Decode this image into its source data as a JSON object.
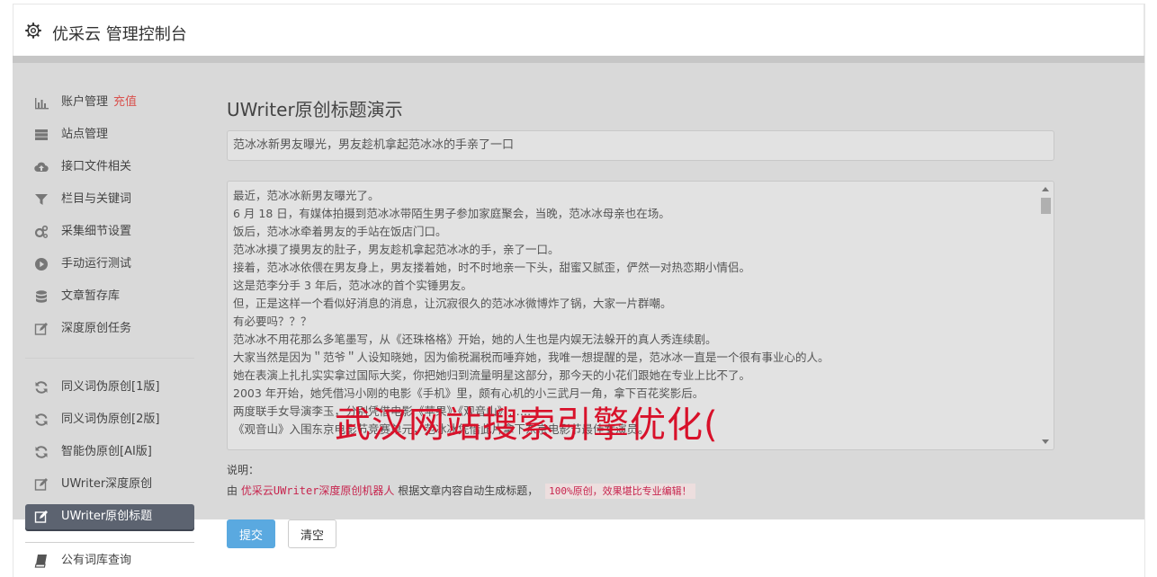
{
  "header": {
    "title": "优采云 管理控制台"
  },
  "sidebar": {
    "items": [
      {
        "label": "账户管理",
        "badge": "充值",
        "icon": "bar-chart-icon"
      },
      {
        "label": "站点管理",
        "icon": "server-icon"
      },
      {
        "label": "接口文件相关",
        "icon": "cloud-upload-icon"
      },
      {
        "label": "栏目与关键词",
        "icon": "filter-icon"
      },
      {
        "label": "采集细节设置",
        "icon": "gears-icon"
      },
      {
        "label": "手动运行测试",
        "icon": "play-icon"
      },
      {
        "label": "文章暂存库",
        "icon": "database-icon"
      },
      {
        "label": "深度原创任务",
        "icon": "edit-icon"
      }
    ],
    "items2": [
      {
        "label": "同义词伪原创[1版]",
        "icon": "refresh-icon"
      },
      {
        "label": "同义词伪原创[2版]",
        "icon": "refresh-icon"
      },
      {
        "label": "智能伪原创[AI版]",
        "icon": "refresh-icon"
      },
      {
        "label": "UWriter深度原创",
        "icon": "edit-icon"
      },
      {
        "label": "UWriter原创标题",
        "icon": "edit-icon",
        "active": true
      }
    ],
    "items3": [
      {
        "label": "公有词库查询",
        "icon": "book-icon"
      }
    ]
  },
  "main": {
    "title": "UWriter原创标题演示",
    "title_input_value": "范冰冰新男友曝光，男友趁机拿起范冰冰的手亲了一口",
    "content_lines": [
      "最近，范冰冰新男友曝光了。",
      "6 月 18 日，有媒体拍摄到范冰冰带陌生男子参加家庭聚会，当晚，范冰冰母亲也在场。",
      "饭后，范冰冰牵着男友的手站在饭店门口。",
      "范冰冰摸了摸男友的肚子，男友趁机拿起范冰冰的手，亲了一口。",
      "接着，范冰冰依偎在男友身上，男友搂着她，时不时地亲一下头，甜蜜又腻歪，俨然一对热恋期小情侣。",
      "这是范李分手 3 年后，范冰冰的首个实锤男友。",
      "但，正是这样一个看似好消息的消息，让沉寂很久的范冰冰微博炸了锅，大家一片群嘲。",
      "有必要吗？？？",
      "范冰冰不用花那么多笔墨写，从《还珠格格》开始，她的人生也是内娱无法躲开的真人秀连续剧。",
      "大家当然是因为＂范爷＂人设知晓她，因为偷税漏税而唾弃她，我唯一想提醒的是，范冰冰一直是一个很有事业心的人。",
      "她在表演上扎扎实实拿过国际大奖，你把她归到流量明星这部分，那今天的小花们跟她在专业上比不了。",
      "2003 年开始，她凭借冯小刚的电影《手机》里，颇有心机的小三武月一角，拿下百花奖影后。",
      "两度联手女导演李玉，分别凭借电影《苹果》《观音山》……",
      "《观音山》入围东京电影节竞赛单元，范冰冰凭借此片拿下东京电影节最佳女演员。"
    ],
    "desc_label": "说明：",
    "desc_prefix": "由",
    "desc_link": "优采云UWriter深度原创机器人",
    "desc_middle": "根据文章内容自动生成标题，",
    "desc_code": "100%原创，效果堪比专业编辑！",
    "submit_label": "提交",
    "clear_label": "清空"
  },
  "watermark": {
    "text": "武汉网站搜索引擎优化("
  },
  "colors": {
    "accent": "#5aa9e0",
    "danger": "#d9534f",
    "watermark": "#d8112a",
    "active_nav": "#5c6370"
  }
}
